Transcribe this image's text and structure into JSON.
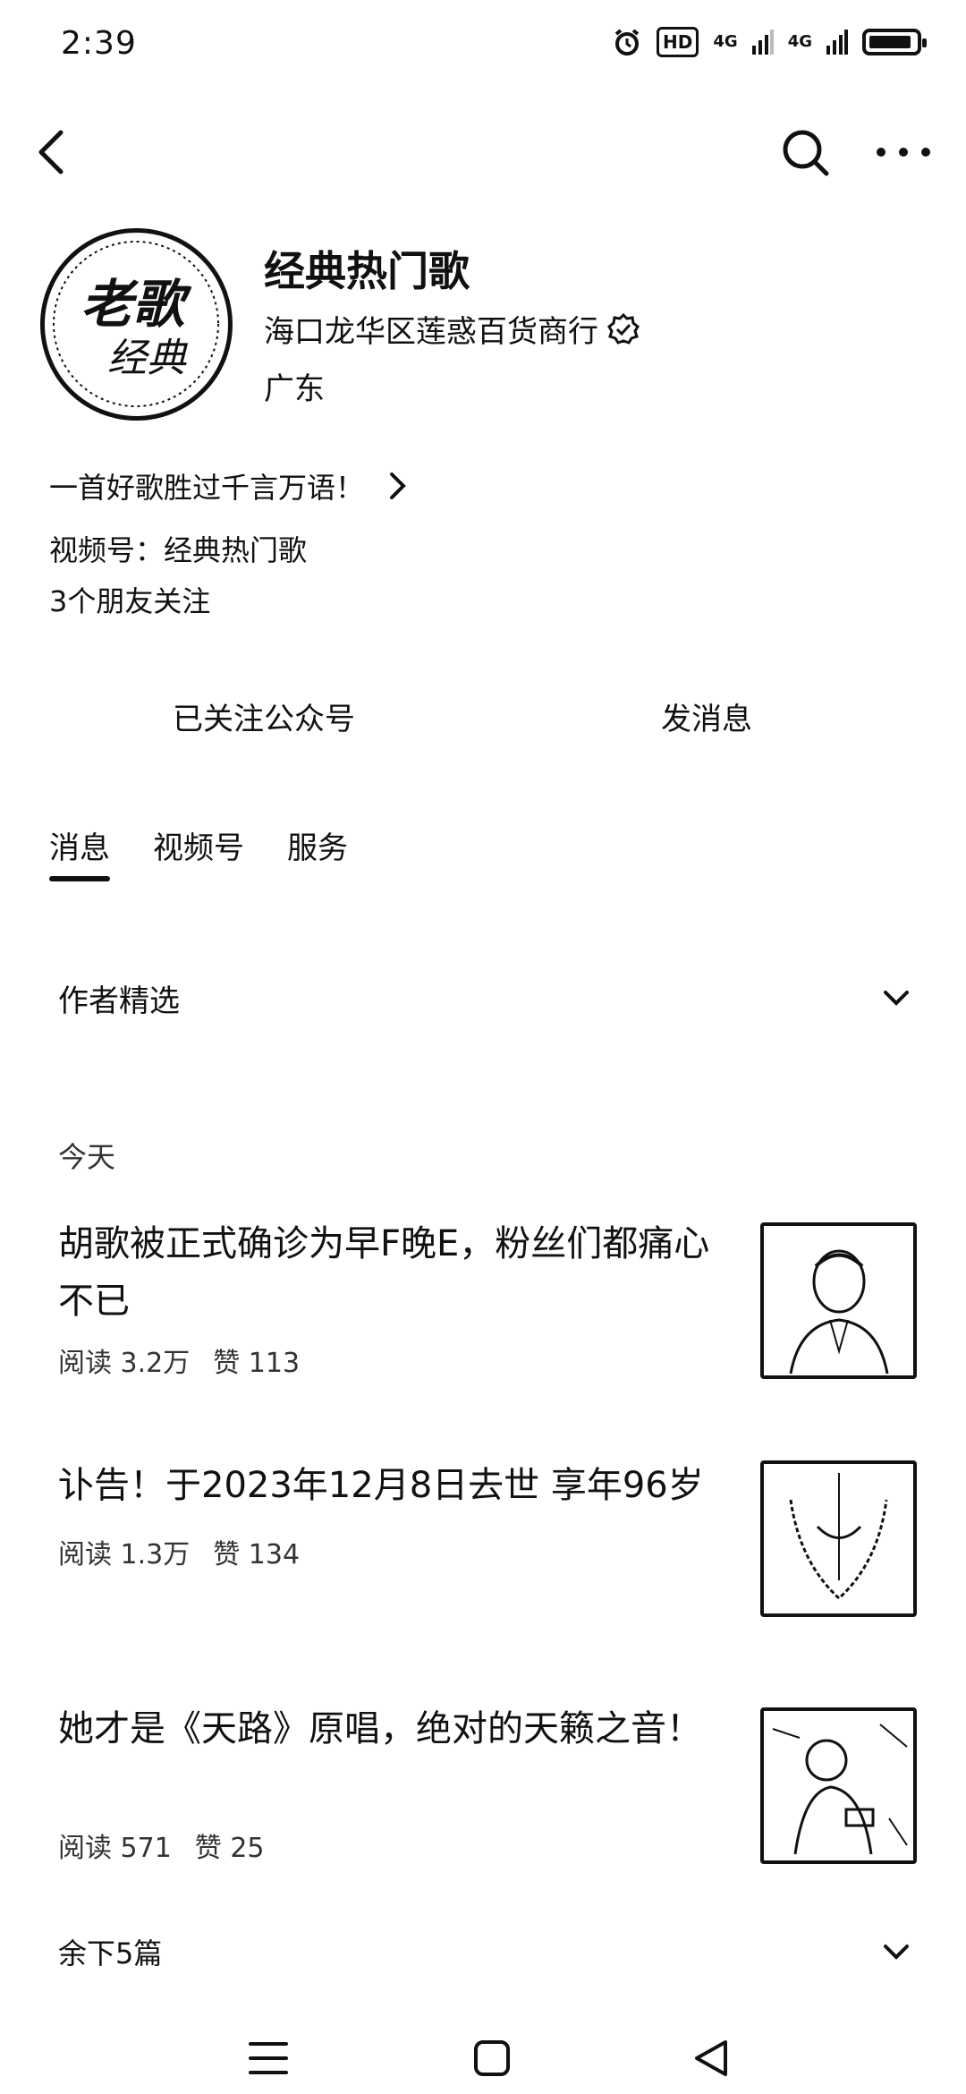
{
  "status_bar": {
    "time": "2:39",
    "hd": "HD",
    "net1": "4G",
    "net2": "4G"
  },
  "profile": {
    "name": "经典热门歌",
    "company": "海口龙华区莲惑百货商行",
    "region": "广东",
    "avatar_text_top": "老歌",
    "avatar_text_bottom": "经典"
  },
  "bio": "一首好歌胜过千言万语！",
  "channel": "视频号：经典热门歌",
  "friends": "3个朋友关注",
  "actions": {
    "follow": "已关注公众号",
    "message": "发消息"
  },
  "tabs": [
    {
      "label": "消息",
      "active": true
    },
    {
      "label": "视频号",
      "active": false
    },
    {
      "label": "服务",
      "active": false
    }
  ],
  "author_section": "作者精选",
  "date_label": "今天",
  "articles": [
    {
      "title": "胡歌被正式确诊为早F晚E，粉丝们都痛心不已",
      "reads": "阅读 3.2万",
      "likes": "赞 113"
    },
    {
      "title": "讣告！于2023年12月8日去世 享年96岁",
      "reads": "阅读 1.3万",
      "likes": "赞 134"
    },
    {
      "title": "她才是《天路》原唱，绝对的天籁之音！",
      "reads": "阅读 571",
      "likes": "赞 25"
    }
  ],
  "remaining": "余下5篇",
  "icons": {
    "back": "back-arrow-icon",
    "search": "search-icon",
    "more": "more-dots-icon",
    "verified": "verified-badge-icon",
    "chevron": "chevron-down-icon"
  }
}
